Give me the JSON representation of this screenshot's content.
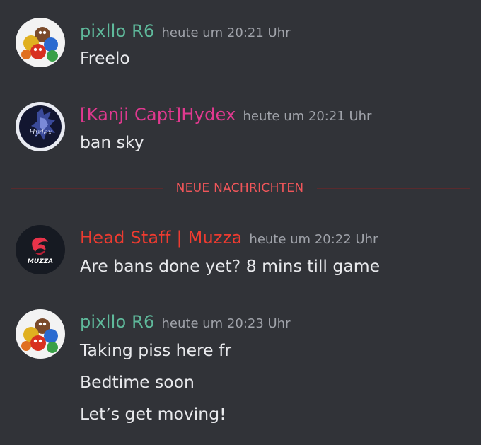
{
  "colors": {
    "background": "#313338",
    "green_role": "#5fb99b",
    "pink_role": "#e0398f",
    "red_role": "#ee3b30",
    "new_messages": "#f0565a",
    "timestamp": "#a0a3aa",
    "message_text": "#e8e9ec"
  },
  "messages": [
    {
      "author": "pixllo R6",
      "timestamp": "heute um 20:21 Uhr",
      "lines": [
        "Freelo"
      ],
      "avatar_icon": "mms-candy-avatar"
    },
    {
      "author": "[Kanji Capt]Hydex",
      "timestamp": "heute um 20:21 Uhr",
      "lines": [
        "ban sky"
      ],
      "avatar_icon": "wolf-hydex-avatar",
      "avatar_text": "Hydex"
    },
    {
      "author": "Head Staff | Muzza",
      "timestamp": "heute um 20:22 Uhr",
      "lines": [
        "Are bans done yet? 8 mins till game"
      ],
      "avatar_icon": "muzza-dragon-avatar",
      "avatar_text": "MUZZA"
    },
    {
      "author": "pixllo R6",
      "timestamp": "heute um 20:23 Uhr",
      "lines": [
        "Taking piss here fr",
        "Bedtime soon",
        "Let’s get moving!"
      ],
      "avatar_icon": "mms-candy-avatar"
    }
  ],
  "divider": {
    "label": "NEUE NACHRICHTEN"
  }
}
